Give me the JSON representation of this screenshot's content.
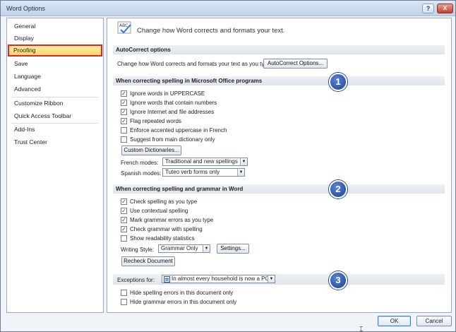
{
  "window": {
    "title": "Word Options",
    "help": "?",
    "close": "x"
  },
  "sidebar": {
    "items": [
      {
        "label": "General"
      },
      {
        "label": "Display"
      },
      {
        "label": "Proofing",
        "selected": true
      },
      {
        "label": "Save"
      },
      {
        "label": "Language"
      },
      {
        "label": "Advanced"
      },
      {
        "label": "Customize Ribbon"
      },
      {
        "label": "Quick Access Toolbar"
      },
      {
        "label": "Add-Ins"
      },
      {
        "label": "Trust Center"
      }
    ]
  },
  "header": {
    "icon": "abc-check-icon",
    "icon_text": "ABC",
    "text": "Change how Word corrects and formats your text."
  },
  "autocorrect": {
    "title": "AutoCorrect options",
    "label": "Change how Word corrects and formats your text as you type:",
    "button": "AutoCorrect Options..."
  },
  "spelling_office": {
    "title": "When correcting spelling in Microsoft Office programs",
    "badge": "1",
    "options": [
      {
        "label": "Ignore words in UPPERCASE",
        "checked": true
      },
      {
        "label": "Ignore words that contain numbers",
        "checked": true
      },
      {
        "label": "Ignore Internet and file addresses",
        "checked": true
      },
      {
        "label": "Flag repeated words",
        "checked": true
      },
      {
        "label": "Enforce accented uppercase in French",
        "checked": false
      },
      {
        "label": "Suggest from main dictionary only",
        "checked": false
      }
    ],
    "dictionaries_button": "Custom Dictionaries...",
    "french_label": "French modes:",
    "french_value": "Traditional and new spellings",
    "spanish_label": "Spanish modes:",
    "spanish_value": "Tuteo verb forms only"
  },
  "spelling_word": {
    "title": "When correcting spelling and grammar in Word",
    "badge": "2",
    "options": [
      {
        "label": "Check spelling as you type",
        "checked": true
      },
      {
        "label": "Use contextual spelling",
        "checked": true
      },
      {
        "label": "Mark grammar errors as you type",
        "checked": true
      },
      {
        "label": "Check grammar with spelling",
        "checked": true
      },
      {
        "label": "Show readability statistics",
        "checked": false
      }
    ],
    "writing_style_label": "Writing Style:",
    "writing_style_value": "Grammar Only",
    "settings_button": "Settings...",
    "recheck_button": "Recheck Document"
  },
  "exceptions": {
    "label": "Exceptions for:",
    "document": "In almost every household is now a PC",
    "badge": "3",
    "options": [
      {
        "label": "Hide spelling errors in this document only",
        "checked": false
      },
      {
        "label": "Hide grammar errors in this document only",
        "checked": false
      }
    ]
  },
  "footer": {
    "ok": "OK",
    "cancel": "Cancel"
  }
}
